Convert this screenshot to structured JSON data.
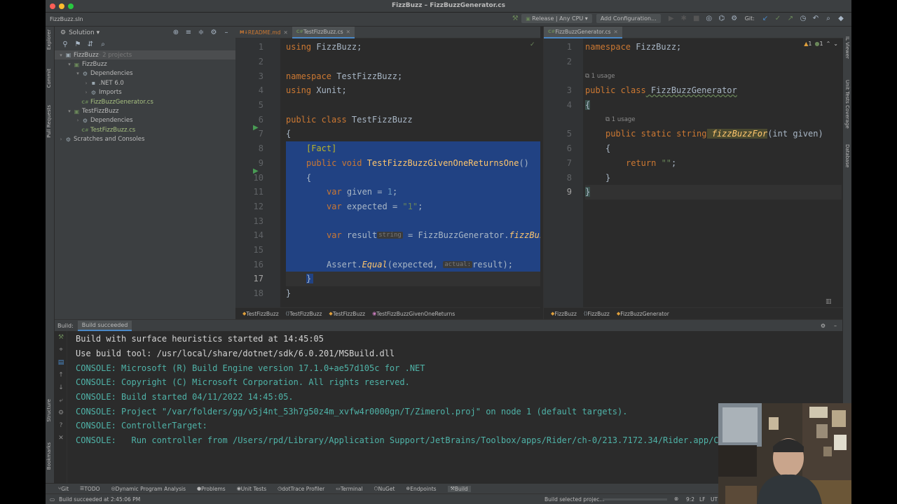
{
  "window": {
    "title": "FizzBuzz – FizzBuzzGenerator.cs",
    "solution_file": "FizzBuzz.sln"
  },
  "toolbar": {
    "run_config": "Release | Any CPU",
    "add_config": "Add Configuration...",
    "git_label": "Git:"
  },
  "left_strip": [
    "Explorer",
    "Commit",
    "Pull Requests",
    "Structure",
    "Bookmarks"
  ],
  "right_strip": [
    "IL Viewer",
    "Unit Tests Coverage",
    "Database"
  ],
  "solution": {
    "header": "Solution",
    "tree": [
      {
        "label": "FizzBuzz",
        "suffix": " · 2 projects",
        "indent": 0,
        "arrow": "▾",
        "icon": "solution-icon",
        "glyph": "▣",
        "color": "#9aa7b0",
        "sel": true
      },
      {
        "label": "FizzBuzz",
        "indent": 1,
        "arrow": "▾",
        "icon": "project-icon",
        "glyph": "▣",
        "color": "#6a8759"
      },
      {
        "label": "Dependencies",
        "indent": 2,
        "arrow": "▾",
        "icon": "dependencies-icon",
        "glyph": "⚙",
        "color": "#9aa7b0"
      },
      {
        "label": ".NET 6.0",
        "indent": 3,
        "arrow": "›",
        "icon": "dotnet-icon",
        "glyph": "▪",
        "color": "#9aa7b0"
      },
      {
        "label": "Imports",
        "indent": 3,
        "arrow": "›",
        "icon": "imports-icon",
        "glyph": "⚙",
        "color": "#9aa7b0"
      },
      {
        "label": "FizzBuzzGenerator.cs",
        "indent": 2,
        "arrow": "",
        "icon": "csharp-file-icon",
        "glyph": "C#",
        "color": "#6a8759",
        "csfile": true
      },
      {
        "label": "TestFizzBuzz",
        "indent": 1,
        "arrow": "▾",
        "icon": "project-icon",
        "glyph": "▣",
        "color": "#6a8759"
      },
      {
        "label": "Dependencies",
        "indent": 2,
        "arrow": "›",
        "icon": "dependencies-icon",
        "glyph": "⚙",
        "color": "#9aa7b0"
      },
      {
        "label": "TestFizzBuzz.cs",
        "indent": 2,
        "arrow": "",
        "icon": "csharp-file-icon",
        "glyph": "C#",
        "color": "#6a8759",
        "csfile": true
      },
      {
        "label": "Scratches and Consoles",
        "indent": 0,
        "arrow": "›",
        "icon": "scratches-icon",
        "glyph": "⚙",
        "color": "#9aa7b0"
      }
    ]
  },
  "editor1": {
    "tabs": [
      {
        "label": "README.md",
        "icon": "markdown-icon",
        "color": "#cc7832",
        "active": false
      },
      {
        "label": "TestFizzBuzz.cs",
        "icon": "csharp-file-icon",
        "color": "#6a8759",
        "active": true
      }
    ],
    "line_numbers": [
      "1",
      "2",
      "3",
      "4",
      "5",
      "6",
      "7",
      "8",
      "9",
      "10",
      "11",
      "12",
      "13",
      "14",
      "15",
      "16",
      "17",
      "18"
    ],
    "breadcrumbs": [
      "TestFizzBuzz",
      "TestFizzBuzz",
      "TestFizzBuzz",
      "TestFizzBuzzGivenOneReturns"
    ],
    "code": {
      "l1_kw": "using",
      "l1_ns": " FizzBuzz;",
      "l3_kw": "namespace",
      "l3_ns": " TestFizzBuzz;",
      "l4_kw": "using",
      "l4_ns": " Xunit;",
      "l6_kw": "public class",
      "l6_name": " TestFizzBuzz",
      "l7": "{",
      "l8": "[Fact]",
      "l9_kw": "public void",
      "l9_fn": " TestFizzBuzzGivenOneReturnsOne",
      "l9_rest": "()",
      "l10": "{",
      "l11_kw": "var",
      "l11_var": " given",
      "l11_eq": " = ",
      "l11_num": "1",
      "l11_end": ";",
      "l12_kw": "var",
      "l12_var": " expected",
      "l12_eq": " = ",
      "l12_str": "\"1\"",
      "l12_end": ";",
      "l14_kw": "var",
      "l14_var": " result",
      "l14_hint": "string",
      "l14_eq": " = FizzBuzzGenerator.",
      "l14_fn": "fizzBuz",
      "l16_cls": "Assert.",
      "l16_fn": "Equal",
      "l16_args": "(expected, ",
      "l16_hint": "actual:",
      "l16_rest": "result);",
      "l17": "}",
      "l18": "}"
    }
  },
  "editor2": {
    "tabs": [
      {
        "label": "FizzBuzzGenerator.cs",
        "icon": "csharp-file-icon",
        "color": "#6a8759",
        "active": true
      }
    ],
    "warnings": "1",
    "hints": "1",
    "line_numbers": [
      "1",
      "2",
      "3",
      "4",
      "5",
      "6",
      "7",
      "8",
      "9"
    ],
    "breadcrumbs": [
      "FizzBuzz",
      "FizzBuzz",
      "FizzBuzzGenerator"
    ],
    "code": {
      "l1_kw": "namespace",
      "l1_ns": " FizzBuzz;",
      "usage1": "1 usage",
      "l3_kw": "public class",
      "l3_name": " FizzBuzzGenerator",
      "l4": "{",
      "usage2": "1 usage",
      "l5_kw": "public static string",
      "l5_fn": " fizzBuzzFor",
      "l5_args": "(int given)",
      "l6": "{",
      "l7_kw": "return",
      "l7_str": " \"\"",
      "l7_end": ";",
      "l8": "}",
      "l9": "}"
    }
  },
  "build": {
    "label": "Build:",
    "tab": "Build succeeded",
    "lines": [
      "Build with surface heuristics started at 14:45:05",
      "Use build tool: /usr/local/share/dotnet/sdk/6.0.201/MSBuild.dll",
      "CONSOLE: Microsoft (R) Build Engine version 17.1.0+ae57d105c for .NET",
      "CONSOLE: Copyright (C) Microsoft Corporation. All rights reserved.",
      "CONSOLE: Build started 04/11/2022 14:45:05.",
      "CONSOLE: Project \"/var/folders/gg/v5j4nt_53h7g50z4m_xvfw4r0000gn/T/Zimerol.proj\" on node 1 (default targets).",
      "CONSOLE: ControllerTarget:",
      "CONSOLE:   Run controller from /Users/rpd/Library/Application Support/JetBrains/Toolbox/apps/Rider/ch-0/213.7172.34/Rider.app/C"
    ]
  },
  "bottom_tools": [
    {
      "label": "Git",
      "icon": "git-icon",
      "glyph": "⑂",
      "name": "tool-git"
    },
    {
      "label": "TODO",
      "icon": "todo-icon",
      "glyph": "☰",
      "name": "tool-todo"
    },
    {
      "label": "Dynamic Program Analysis",
      "icon": "dpa-icon",
      "glyph": "◎",
      "name": "tool-dpa"
    },
    {
      "label": "Problems",
      "icon": "problems-icon",
      "glyph": "●",
      "name": "tool-problems"
    },
    {
      "label": "Unit Tests",
      "icon": "unit-tests-icon",
      "glyph": "◉",
      "name": "tool-unit-tests"
    },
    {
      "label": "dotTrace Profiler",
      "icon": "profiler-icon",
      "glyph": "◷",
      "name": "tool-profiler"
    },
    {
      "label": "Terminal",
      "icon": "terminal-icon",
      "glyph": "▭",
      "name": "tool-terminal"
    },
    {
      "label": "NuGet",
      "icon": "nuget-icon",
      "glyph": "⬡",
      "name": "tool-nuget"
    },
    {
      "label": "Endpoints",
      "icon": "endpoints-icon",
      "glyph": "⊕",
      "name": "tool-endpoints"
    },
    {
      "label": "Build",
      "icon": "build-icon",
      "glyph": "⚒",
      "name": "tool-build"
    }
  ],
  "status": {
    "message": "Build succeeded at 2:45:06 PM",
    "progress_text": "Build selected projec...",
    "position": "9:2",
    "line_sep": "LF",
    "encoding": "UT"
  }
}
